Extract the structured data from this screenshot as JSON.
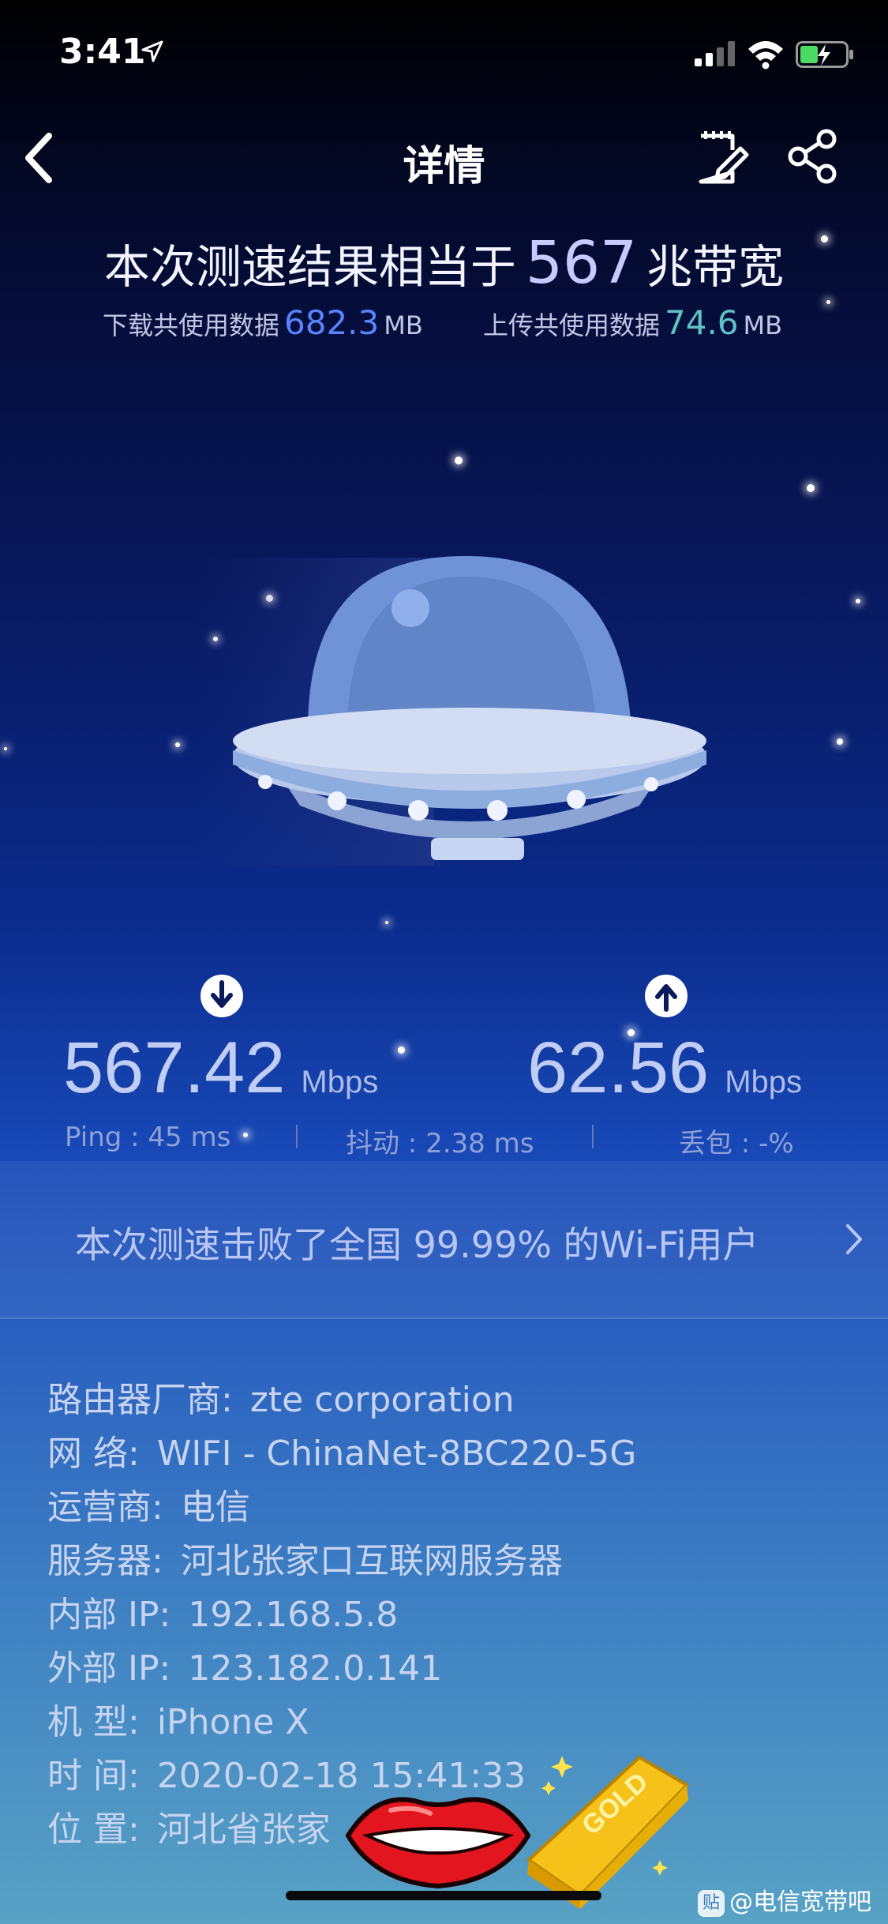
{
  "status_bar": {
    "time": "3:41"
  },
  "nav": {
    "title": "详情"
  },
  "summary": {
    "prefix": "本次测速结果相当于",
    "bandwidth": "567",
    "suffix": "兆带宽",
    "download_label": "下载共使用数据",
    "download_value": "682.3",
    "download_unit": "MB",
    "upload_label": "上传共使用数据",
    "upload_value": "74.6",
    "upload_unit": "MB"
  },
  "speeds": {
    "download": "567.42",
    "download_unit": "Mbps",
    "upload": "62.56",
    "upload_unit": "Mbps"
  },
  "metrics": {
    "ping": "Ping : 45 ms",
    "jitter": "抖动 : 2.38 ms",
    "loss": "丢包 : -%"
  },
  "result": {
    "text": "本次测速击败了全国 99.99% 的Wi-Fi用户"
  },
  "details": [
    {
      "key": "路由器厂商:",
      "value": "zte corporation"
    },
    {
      "key": "网 络:",
      "value": "WIFI - ChinaNet-8BC220-5G"
    },
    {
      "key": "运营商:",
      "value": "电信"
    },
    {
      "key": "服务器:",
      "value": "河北张家口互联网服务器"
    },
    {
      "key": "内部 IP:",
      "value": "192.168.5.8"
    },
    {
      "key": "外部 IP:",
      "value": "123.182.0.141"
    },
    {
      "key": "机 型:",
      "value": "iPhone X"
    },
    {
      "key": "时 间:",
      "value": "2020-02-18 15:41:33"
    },
    {
      "key": "位 置:",
      "value": "河北省张家"
    }
  ],
  "overlay": {
    "gold_text": "GOLD",
    "watermark_badge": "贴",
    "watermark": "@电信宽带吧"
  },
  "icons": {
    "back": "chevron-left-icon",
    "edit": "edit-note-icon",
    "share": "share-icon",
    "download": "arrow-down-circle-icon",
    "upload": "arrow-up-circle-icon"
  }
}
